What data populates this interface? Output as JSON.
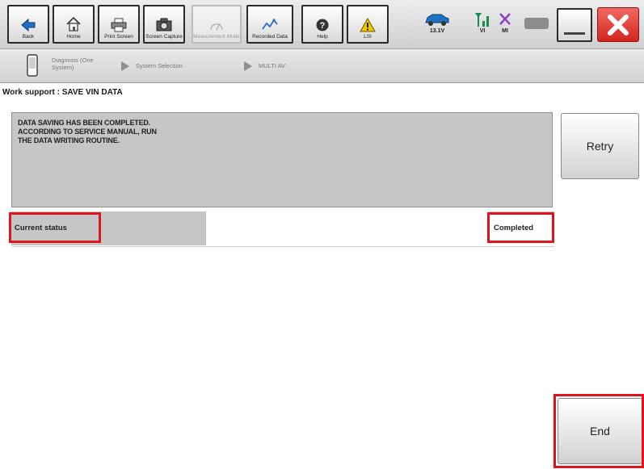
{
  "toolbar": {
    "back_label": "Back",
    "home_label": "Home",
    "print_label": "Print Screen",
    "capture_label": "Screen Capture",
    "measurement_label": "Measurement Mode",
    "recorded_label": "Recorded Data",
    "help_label": "Help",
    "lsi_label": "LSI",
    "battery_value": "13.1V",
    "signal_label": "VI",
    "mi_label": "MI"
  },
  "breadcrumb": {
    "item1": "Diagnosis (One System)",
    "item2": "System Selection",
    "item3": "MULTI AV"
  },
  "work_support": {
    "title": "Work support : SAVE VIN DATA",
    "message_lines": [
      "DATA SAVING HAS BEEN COMPLETED.",
      "ACCORDING TO SERVICE MANUAL, RUN",
      "THE DATA WRITING ROUTINE."
    ],
    "retry_label": "Retry",
    "status_label": "Current status",
    "status_value": "Completed",
    "end_label": "End"
  },
  "colors": {
    "highlight": "#e0141c",
    "panel_gray": "#c6c6c6",
    "close_red": "#e0312c"
  }
}
